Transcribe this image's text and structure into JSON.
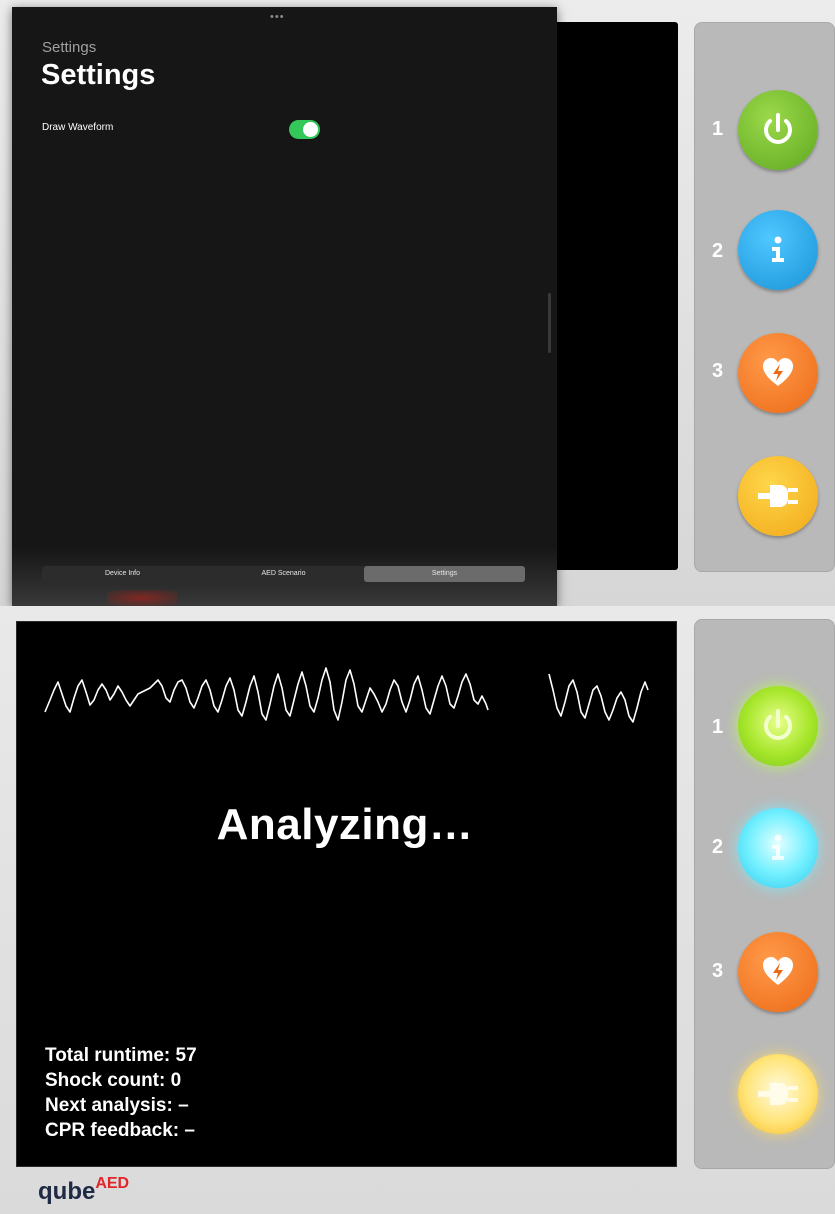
{
  "settings_sheet": {
    "grabber": "•••",
    "caption": "Settings",
    "title": "Settings",
    "rows": [
      {
        "label": "Draw Waveform",
        "enabled": true
      }
    ],
    "tabs": [
      {
        "label": "Device Info",
        "active": false
      },
      {
        "label": "AED Scenario",
        "active": false
      },
      {
        "label": "Settings",
        "active": true
      }
    ]
  },
  "aed_screen": {
    "status": "Analyzing…",
    "stats": [
      "Total runtime: 57",
      "Shock count: 0",
      "Next analysis: –",
      "CPR feedback: –"
    ]
  },
  "side_buttons": {
    "top": [
      {
        "number": "1",
        "icon": "power-icon",
        "color": "#7cc51e",
        "lit": false
      },
      {
        "number": "2",
        "icon": "info-icon",
        "color": "#2aa8ec",
        "lit": false
      },
      {
        "number": "3",
        "icon": "heart-shock-icon",
        "color": "#f07a20",
        "lit": false
      },
      {
        "number": "",
        "icon": "plug-icon",
        "color": "#f5b820",
        "lit": false
      }
    ],
    "bottom": [
      {
        "number": "1",
        "icon": "power-icon",
        "color": "#a6e62a",
        "lit": true
      },
      {
        "number": "2",
        "icon": "info-icon",
        "color": "#74f0ff",
        "lit": true
      },
      {
        "number": "3",
        "icon": "heart-shock-icon",
        "color": "#f07a20",
        "lit": false
      },
      {
        "number": "",
        "icon": "plug-icon",
        "color": "#ffe478",
        "lit": true
      }
    ]
  },
  "brand": {
    "name": "qube",
    "suffix": "AED"
  },
  "colors": {
    "toggle_on": "#34c759",
    "screen": "#000000",
    "panel": "#b9b9b9"
  }
}
